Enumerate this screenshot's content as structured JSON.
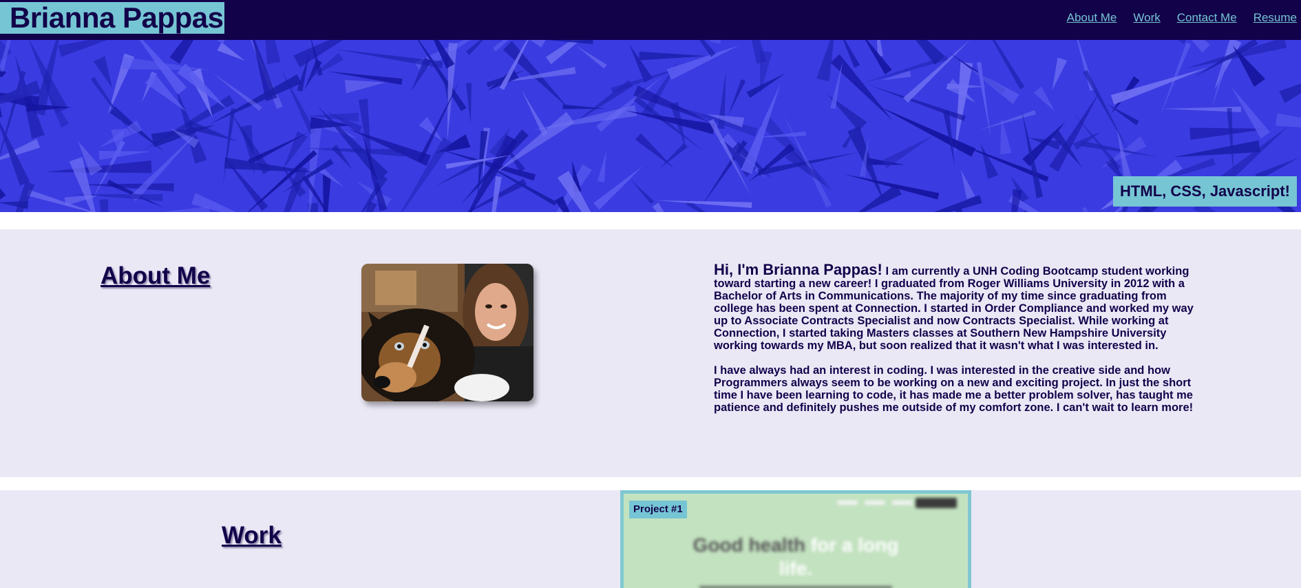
{
  "header": {
    "site_title": "Brianna Pappas",
    "nav": [
      "About Me",
      "Work",
      "Contact Me",
      "Resume"
    ]
  },
  "hero": {
    "tagline": "HTML, CSS, Javascript!"
  },
  "about": {
    "heading": "About Me",
    "photo_alt": "Brianna with her dog",
    "greeting": "Hi, I'm Brianna Pappas!",
    "paragraph_1": "I am currently a UNH Coding Bootcamp student working toward starting a new career! I graduated from Roger Williams University in 2012 with a Bachelor of Arts in Communications. The majority of my time since graduating from college has been spent at Connection. I started in Order Compliance and worked my way up to Associate Contracts Specialist and now Contracts Specialist. While working at Connection, I started taking Masters classes at Southern New Hampshire University working towards my MBA, but soon realized that it wasn't what I was interested in.",
    "paragraph_2": "I have always had an interest in coding. I was interested in the creative side and how Programmers always seem to be working on a new and exciting project. In just the short time I have been learning to code, it has made me a better problem solver, has taught me patience and definitely pushes me outside of my comfort zone. I can't wait to learn more!"
  },
  "work": {
    "heading": "Work",
    "projects": [
      {
        "label": "Project #1",
        "preview_headline_dark": "Good health",
        "preview_headline_light": " for a long life."
      }
    ]
  },
  "colors": {
    "header_bg": "#12024a",
    "accent": "#76c5d4",
    "section_bg": "#ebe8f6",
    "hero_bg": "#3a3be0"
  }
}
